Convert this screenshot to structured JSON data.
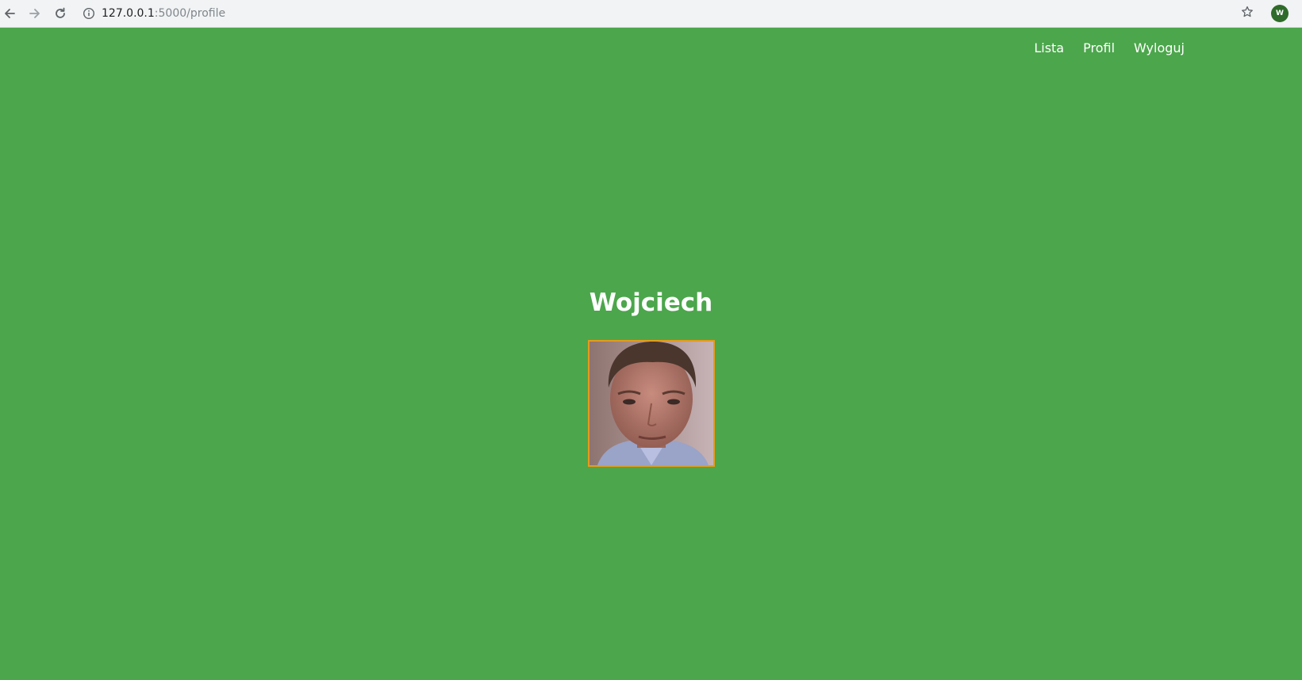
{
  "browser": {
    "url_host": "127.0.0.1",
    "url_path": ":5000/profile",
    "profile_initial": "W",
    "icons": {
      "back": "arrow-left-icon",
      "forward": "arrow-right-icon",
      "reload": "reload-icon",
      "info": "info-icon",
      "bookmark": "star-icon"
    }
  },
  "nav": {
    "items": [
      {
        "label": "Lista"
      },
      {
        "label": "Profil"
      },
      {
        "label": "Wyloguj"
      }
    ]
  },
  "profile": {
    "name": "Wojciech"
  },
  "colors": {
    "page_background": "#4ca64c",
    "photo_border": "#e89a1c",
    "avatar": "#2f6b2a"
  }
}
